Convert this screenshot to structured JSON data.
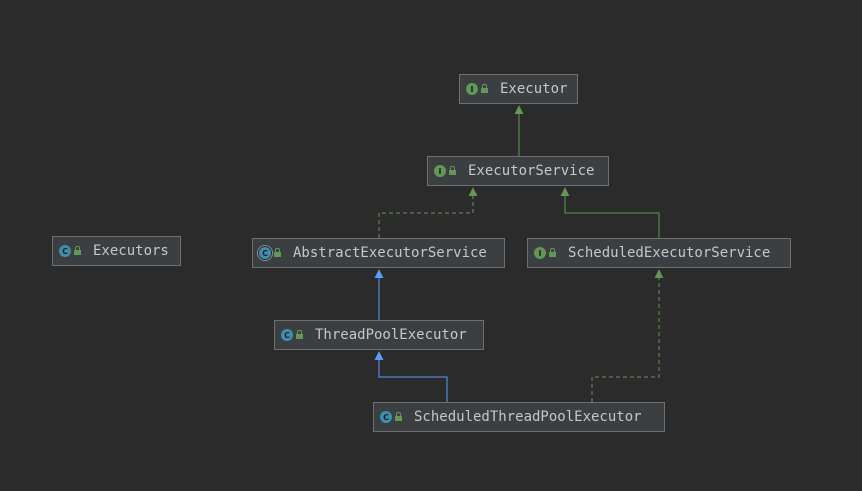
{
  "diagram": {
    "nodes": [
      {
        "id": "executor",
        "label": "Executor",
        "kind": "interface",
        "icon": "interface-icon",
        "visibility": "public-access-icon"
      },
      {
        "id": "executor-service",
        "label": "ExecutorService",
        "kind": "interface",
        "icon": "interface-icon",
        "visibility": "public-access-icon"
      },
      {
        "id": "executors",
        "label": "Executors",
        "kind": "class",
        "icon": "class-icon",
        "visibility": "public-access-icon"
      },
      {
        "id": "abstract-executor-service",
        "label": "AbstractExecutorService",
        "kind": "abstract-class",
        "icon": "abstract-class-icon",
        "visibility": "public-access-icon"
      },
      {
        "id": "scheduled-executor-service",
        "label": "ScheduledExecutorService",
        "kind": "interface",
        "icon": "interface-icon",
        "visibility": "public-access-icon"
      },
      {
        "id": "thread-pool-executor",
        "label": "ThreadPoolExecutor",
        "kind": "class",
        "icon": "class-icon",
        "visibility": "public-access-icon"
      },
      {
        "id": "scheduled-thread-pool-executor",
        "label": "ScheduledThreadPoolExecutor",
        "kind": "class",
        "icon": "class-icon",
        "visibility": "public-access-icon"
      }
    ],
    "edges": [
      {
        "from": "executor-service",
        "to": "executor",
        "relation": "extends",
        "line": "solid"
      },
      {
        "from": "abstract-executor-service",
        "to": "executor-service",
        "relation": "implements",
        "line": "dashed"
      },
      {
        "from": "scheduled-executor-service",
        "to": "executor-service",
        "relation": "extends",
        "line": "solid"
      },
      {
        "from": "thread-pool-executor",
        "to": "abstract-executor-service",
        "relation": "extends",
        "line": "solid"
      },
      {
        "from": "scheduled-thread-pool-executor",
        "to": "thread-pool-executor",
        "relation": "extends",
        "line": "solid"
      },
      {
        "from": "scheduled-thread-pool-executor",
        "to": "scheduled-executor-service",
        "relation": "implements",
        "line": "dashed"
      }
    ],
    "colors": {
      "background": "#2b2b2b",
      "node_fill": "#3c3f41",
      "node_border": "#6f6f6f",
      "node_text": "#c6c6c6",
      "interface_edge": "#629755",
      "class_edge": "#589df6"
    },
    "icon_glyphs": {
      "interface": "I",
      "class": "C",
      "abstract-class": "C"
    }
  }
}
